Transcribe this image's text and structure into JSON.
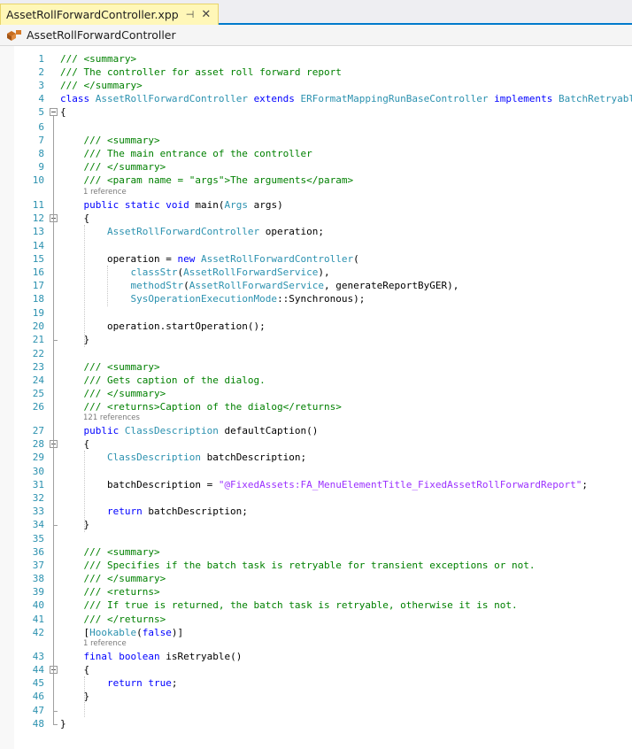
{
  "tab": {
    "title": "AssetRollForwardController.xpp",
    "pin_glyph": "⊣",
    "close_glyph": "✕"
  },
  "navbar": {
    "class_name": "AssetRollForwardController"
  },
  "refs": {
    "r11": "1 reference",
    "r27": "121 references",
    "r43": "1 reference"
  },
  "lines": [
    [
      [
        "c",
        "/// <summary>"
      ]
    ],
    [
      [
        "c",
        "/// The controller for asset roll forward report"
      ]
    ],
    [
      [
        "c",
        "/// </summary>"
      ]
    ],
    [
      [
        "k",
        "class "
      ],
      [
        "t",
        "AssetRollForwardController"
      ],
      [
        "p",
        " "
      ],
      [
        "k",
        "extends "
      ],
      [
        "t",
        "ERFormatMappingRunBaseController"
      ],
      [
        "p",
        " "
      ],
      [
        "k",
        "implements "
      ],
      [
        "t",
        "BatchRetryable"
      ]
    ],
    [
      [
        "p",
        "{"
      ]
    ],
    [],
    [
      [
        "p",
        "    "
      ],
      [
        "c",
        "/// <summary>"
      ]
    ],
    [
      [
        "p",
        "    "
      ],
      [
        "c",
        "/// The main entrance of the controller"
      ]
    ],
    [
      [
        "p",
        "    "
      ],
      [
        "c",
        "/// </summary>"
      ]
    ],
    [
      [
        "p",
        "    "
      ],
      [
        "c",
        "/// <param name = \"args\">The arguments</param>"
      ]
    ],
    [
      [
        "p",
        "    "
      ],
      [
        "k",
        "public static void "
      ],
      [
        "p",
        "main("
      ],
      [
        "t",
        "Args"
      ],
      [
        "p",
        " args)"
      ]
    ],
    [
      [
        "p",
        "    {"
      ]
    ],
    [
      [
        "p",
        "        "
      ],
      [
        "t",
        "AssetRollForwardController"
      ],
      [
        "p",
        " operation;"
      ]
    ],
    [],
    [
      [
        "p",
        "        operation = "
      ],
      [
        "k",
        "new "
      ],
      [
        "t",
        "AssetRollForwardController"
      ],
      [
        "p",
        "("
      ]
    ],
    [
      [
        "p",
        "            "
      ],
      [
        "t",
        "classStr"
      ],
      [
        "p",
        "("
      ],
      [
        "t",
        "AssetRollForwardService"
      ],
      [
        "p",
        "),"
      ]
    ],
    [
      [
        "p",
        "            "
      ],
      [
        "t",
        "methodStr"
      ],
      [
        "p",
        "("
      ],
      [
        "t",
        "AssetRollForwardService"
      ],
      [
        "p",
        ", generateReportByGER),"
      ]
    ],
    [
      [
        "p",
        "            "
      ],
      [
        "t",
        "SysOperationExecutionMode"
      ],
      [
        "p",
        "::Synchronous);"
      ]
    ],
    [],
    [
      [
        "p",
        "        operation.startOperation();"
      ]
    ],
    [
      [
        "p",
        "    }"
      ]
    ],
    [],
    [
      [
        "p",
        "    "
      ],
      [
        "c",
        "/// <summary>"
      ]
    ],
    [
      [
        "p",
        "    "
      ],
      [
        "c",
        "/// Gets caption of the dialog."
      ]
    ],
    [
      [
        "p",
        "    "
      ],
      [
        "c",
        "/// </summary>"
      ]
    ],
    [
      [
        "p",
        "    "
      ],
      [
        "c",
        "/// <returns>Caption of the dialog</returns>"
      ]
    ],
    [
      [
        "p",
        "    "
      ],
      [
        "k",
        "public "
      ],
      [
        "t",
        "ClassDescription"
      ],
      [
        "p",
        " defaultCaption()"
      ]
    ],
    [
      [
        "p",
        "    {"
      ]
    ],
    [
      [
        "p",
        "        "
      ],
      [
        "t",
        "ClassDescription"
      ],
      [
        "p",
        " batchDescription;"
      ]
    ],
    [],
    [
      [
        "p",
        "        batchDescription = "
      ],
      [
        "l",
        "\"@FixedAssets:FA_MenuElementTitle_FixedAssetRollForwardReport\""
      ],
      [
        "p",
        ";"
      ]
    ],
    [],
    [
      [
        "p",
        "        "
      ],
      [
        "k",
        "return "
      ],
      [
        "p",
        "batchDescription;"
      ]
    ],
    [
      [
        "p",
        "    }"
      ]
    ],
    [],
    [
      [
        "p",
        "    "
      ],
      [
        "c",
        "/// <summary>"
      ]
    ],
    [
      [
        "p",
        "    "
      ],
      [
        "c",
        "/// Specifies if the batch task is retryable for transient exceptions or not."
      ]
    ],
    [
      [
        "p",
        "    "
      ],
      [
        "c",
        "/// </summary>"
      ]
    ],
    [
      [
        "p",
        "    "
      ],
      [
        "c",
        "/// <returns>"
      ]
    ],
    [
      [
        "p",
        "    "
      ],
      [
        "c",
        "/// If true is returned, the batch task is retryable, otherwise it is not."
      ]
    ],
    [
      [
        "p",
        "    "
      ],
      [
        "c",
        "/// </returns>"
      ]
    ],
    [
      [
        "p",
        "    ["
      ],
      [
        "t",
        "Hookable"
      ],
      [
        "p",
        "("
      ],
      [
        "k",
        "false"
      ],
      [
        "p",
        ")]"
      ]
    ],
    [
      [
        "p",
        "    "
      ],
      [
        "k",
        "final boolean "
      ],
      [
        "p",
        "isRetryable()"
      ]
    ],
    [
      [
        "p",
        "    {"
      ]
    ],
    [
      [
        "p",
        "        "
      ],
      [
        "k",
        "return true"
      ],
      [
        "p",
        ";"
      ]
    ],
    [
      [
        "p",
        "    }"
      ]
    ],
    [],
    [
      [
        "p",
        "}"
      ]
    ]
  ],
  "line_numbers": [
    "1",
    "2",
    "3",
    "4",
    "5",
    "6",
    "7",
    "8",
    "9",
    "10",
    "11",
    "12",
    "13",
    "14",
    "15",
    "16",
    "17",
    "18",
    "19",
    "20",
    "21",
    "22",
    "23",
    "24",
    "25",
    "26",
    "27",
    "28",
    "29",
    "30",
    "31",
    "32",
    "33",
    "34",
    "35",
    "36",
    "37",
    "38",
    "39",
    "40",
    "41",
    "42",
    "43",
    "44",
    "45",
    "46",
    "47",
    "48"
  ],
  "colors": {
    "comment": "#008000",
    "keyword": "#0000ff",
    "type": "#2b91af",
    "label_string": "#9b30ff",
    "accent": "#007acc"
  }
}
